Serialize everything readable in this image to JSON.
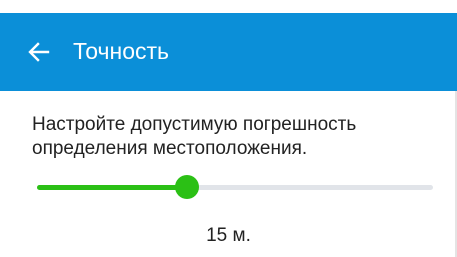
{
  "header": {
    "title": "Точность",
    "back_icon": "arrow-left-icon",
    "background_color": "#0b8fd8"
  },
  "content": {
    "description": "Настройте допустимую погрешность определения местоположения.",
    "slider": {
      "value_label": "15 м.",
      "fraction": 0.38,
      "accent_color": "#2bc015"
    }
  }
}
